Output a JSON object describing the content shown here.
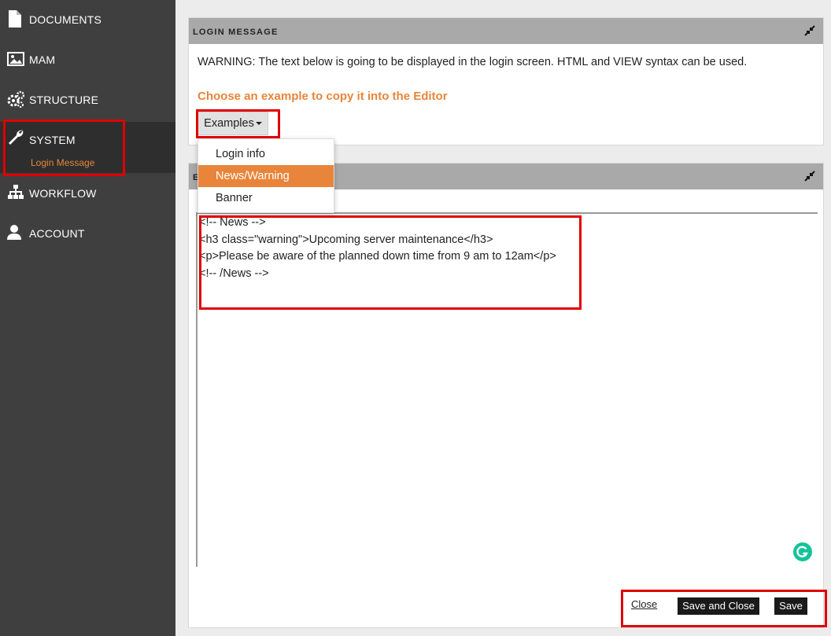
{
  "sidebar": {
    "items": [
      {
        "label": "DOCUMENTS",
        "icon": "document-icon"
      },
      {
        "label": "MAM",
        "icon": "image-icon"
      },
      {
        "label": "STRUCTURE",
        "icon": "gears-icon"
      },
      {
        "label": "SYSTEM",
        "icon": "wrench-icon",
        "active": true,
        "sub_label": "Login Message"
      },
      {
        "label": "WORKFLOW",
        "icon": "sitemap-icon"
      },
      {
        "label": "ACCOUNT",
        "icon": "user-icon"
      }
    ]
  },
  "login_panel": {
    "title": "LOGIN MESSAGE",
    "warning": "WARNING: The text below is going to be displayed in the login screen. HTML and VIEW syntax can be used.",
    "choose_example": "Choose an example to copy it into the Editor",
    "examples_label": "Examples"
  },
  "dropdown": {
    "items": [
      "Login info",
      "News/Warning",
      "Banner"
    ],
    "selected": "News/Warning"
  },
  "editor_panel": {
    "title_fragment": "E",
    "code_lines": [
      "<!-- News -->",
      "<h3 class=\"warning\">Upcoming server maintenance</h3>",
      "<p>Please be aware of the planned down time from 9 am to 12am</p>",
      "<!-- /News -->"
    ]
  },
  "footer": {
    "close_label": "Close",
    "save_close_label": "Save and Close",
    "save_label": "Save"
  },
  "colors": {
    "sidebar_bg": "#3f3f3f",
    "accent": "#e8853a",
    "highlight": "#e00000"
  }
}
